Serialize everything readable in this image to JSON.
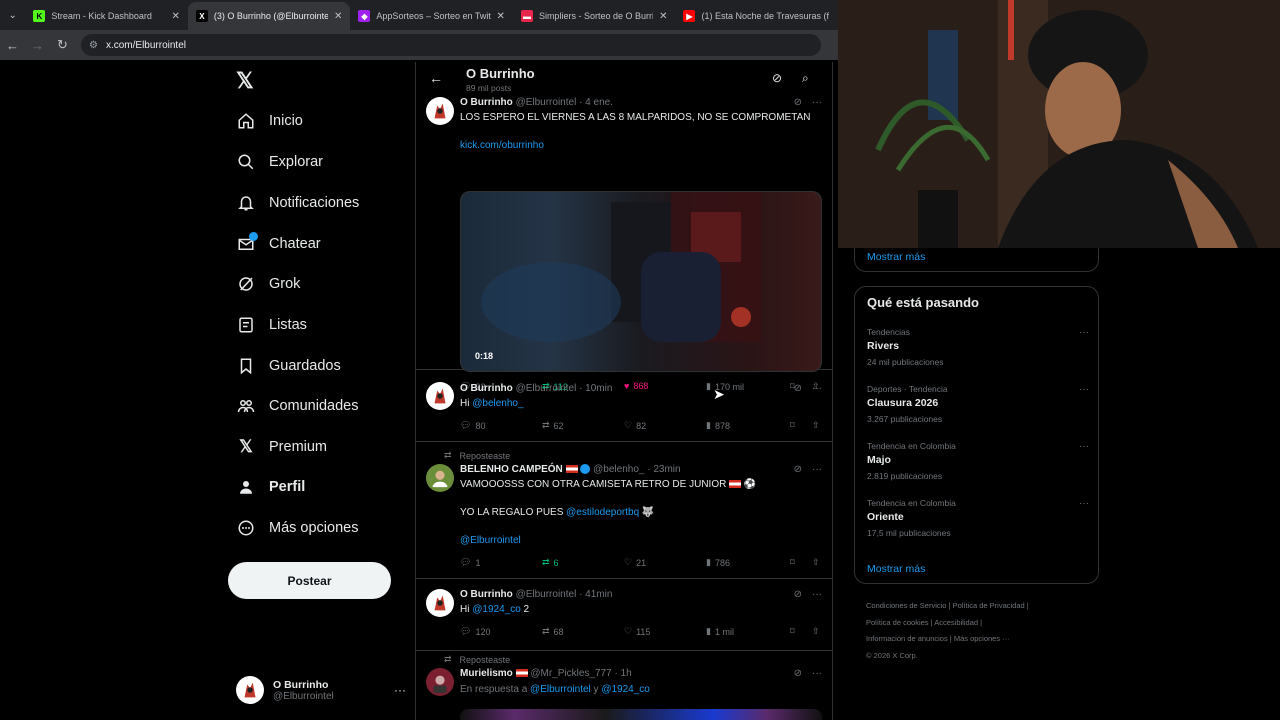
{
  "browser": {
    "tabs": [
      {
        "title": "Stream - Kick Dashboard",
        "fav_color": "#53fc18",
        "fav_glyph": "K",
        "active": false
      },
      {
        "title": "(3) O Burrinho (@Elburrointel) /",
        "fav_color": "#000000",
        "fav_glyph": "X",
        "active": true
      },
      {
        "title": "AppSorteos – Sorteo en Twitter",
        "fav_color": "#a020f0",
        "fav_glyph": "◆",
        "active": false
      },
      {
        "title": "Simpliers - Sorteo de O Burrinh",
        "fav_color": "#e8264b",
        "fav_glyph": "▬",
        "active": false
      },
      {
        "title": "(1) Esta Noche de Travesuras (f",
        "fav_color": "#ff0000",
        "fav_glyph": "▶",
        "active": false
      }
    ],
    "url": "x.com/Elburrointel"
  },
  "sidebar": {
    "items": [
      {
        "label": "Inicio",
        "icon": "home-icon",
        "glyph": "⌂"
      },
      {
        "label": "Explorar",
        "icon": "search-icon",
        "glyph": "⌕"
      },
      {
        "label": "Notificaciones",
        "icon": "bell-icon",
        "glyph": "🔔"
      },
      {
        "label": "Chatear",
        "icon": "mail-icon",
        "glyph": "✉"
      },
      {
        "label": "Grok",
        "icon": "grok-icon",
        "glyph": "⊘"
      },
      {
        "label": "Listas",
        "icon": "list-icon",
        "glyph": "☰"
      },
      {
        "label": "Guardados",
        "icon": "bookmark-icon",
        "glyph": "⌑"
      },
      {
        "label": "Comunidades",
        "icon": "communities-icon",
        "glyph": "👥"
      },
      {
        "label": "Premium",
        "icon": "x-logo-icon",
        "glyph": "𝕏"
      },
      {
        "label": "Perfil",
        "icon": "profile-icon",
        "glyph": "👤"
      },
      {
        "label": "Más opciones",
        "icon": "more-circle-icon",
        "glyph": "⋯"
      }
    ],
    "post_label": "Postear",
    "account": {
      "name": "O Burrinho",
      "handle": "@Elburrointel"
    }
  },
  "header": {
    "title": "O Burrinho",
    "subtitle": "89 mil posts"
  },
  "posts": [
    {
      "name": "O Burrinho",
      "handle": "@Elburrointel",
      "time": "· 4 ene.",
      "lines": [
        "LOS ESPERO EL VIERNES A LAS 8 MALPARIDOS, NO SE COMPROMETAN"
      ],
      "link": "kick.com/oburrinho",
      "video_duration": "0:18",
      "replies": "92",
      "reposts": "112",
      "likes": "868",
      "views": "170 mil"
    },
    {
      "name": "O Burrinho",
      "handle": "@Elburrointel",
      "time": "· 10min",
      "text_prefix": "Hi ",
      "mention": "@belenho_",
      "replies": "80",
      "reposts": "62",
      "likes": "82",
      "views": "878"
    },
    {
      "reposted": "Reposteaste",
      "name": "BELENHO CAMPEÓN",
      "handle": "@belenho_",
      "time": "· 23min",
      "line1": "VAMOOOSSS CON OTRA CAMISETA RETRO DE JUNIOR",
      "line2_prefix": "YO LA REGALO PUES ",
      "line2_mention": "@estilodeportbq",
      "line3_mention": "@Elburrointel",
      "replies": "1",
      "reposts": "6",
      "likes": "21",
      "views": "786"
    },
    {
      "name": "O Burrinho",
      "handle": "@Elburrointel",
      "time": "· 41min",
      "text_prefix": "Hi ",
      "mention": "@1924_co",
      "text_suffix": " 2",
      "replies": "120",
      "reposts": "68",
      "likes": "115",
      "views": "1 mil"
    },
    {
      "reposted": "Reposteaste",
      "name": "Murielismo",
      "handle": "@Mr_Pickles_777",
      "time": "· 1h",
      "reply_prefix": "En respuesta a ",
      "reply_to1": "@Elburrointel",
      "reply_mid": " y ",
      "reply_to2": "@1924_co"
    }
  ],
  "right": {
    "show_more_top": "Mostrar más",
    "trends_title": "Qué está pasando",
    "trends": [
      {
        "category": "Tendencias",
        "name": "Rivers",
        "count": "24 mil publicaciones"
      },
      {
        "category": "Deportes · Tendencia",
        "name": "Clausura 2026",
        "count": "3.267 publicaciones"
      },
      {
        "category": "Tendencia en Colombia",
        "name": "Majo",
        "count": "2.819 publicaciones"
      },
      {
        "category": "Tendencia en Colombia",
        "name": "Oriente",
        "count": "17,5 mil publicaciones"
      }
    ],
    "show_more": "Mostrar más",
    "footer": [
      "Condiciones de Servicio  |  Política de Privacidad  |",
      "Política de cookies  |  Accesibilidad  |",
      "Información de anuncios  |  Más opciones ···",
      "© 2026 X Corp."
    ]
  }
}
